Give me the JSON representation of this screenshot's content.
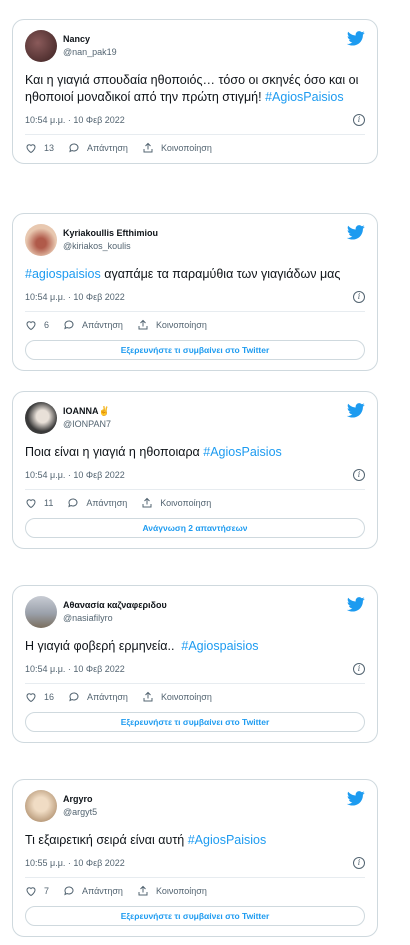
{
  "tweets": [
    {
      "display_name": "Nancy",
      "username": "@nan_pak19",
      "text_plain": "Και η γιαγιά σπουδαία ηθοποιός… τόσο οι σκηνές όσο και οι ηθοποιοί μοναδικοί από την πρώτη στιγμή! ",
      "hashtag": "#AgiosPaisios",
      "timestamp": "10:54 μ.μ. · 10 Φεβ 2022",
      "likes": "13",
      "reply_label": "Απάντηση",
      "share_label": "Κοινοποίηση",
      "avatar_color": "#5a3a3a"
    },
    {
      "display_name": "Kyriakoullis Efthimiou",
      "username": "@kiriakos_koulis",
      "hashtag_first": "#agiospaisios",
      "text_after": " αγαπάμε τα παραμύθια των γιαγιάδων μας",
      "timestamp": "10:54 μ.μ. · 10 Φεβ 2022",
      "likes": "6",
      "reply_label": "Απάντηση",
      "share_label": "Κοινοποίηση",
      "button_label": "Εξερευνήστε τι συμβαίνει στο Twitter",
      "avatar_color": "#c98a7a"
    },
    {
      "display_name": "IOANNA✌",
      "username": "@IONPAN7",
      "text_plain": "Ποια είναι η γιαγιά η ηθοποιαρα ",
      "hashtag": "#AgiosPaisios",
      "timestamp": "10:54 μ.μ. · 10 Φεβ 2022",
      "likes": "11",
      "reply_label": "Απάντηση",
      "share_label": "Κοινοποίηση",
      "button_label": "Ανάγνωση 2 απαντήσεων",
      "avatar_color": "#2b2b2b"
    },
    {
      "display_name": "Αθανασία καζναφεριδου",
      "username": "@nasiafilyro",
      "text_plain": "Η γιαγιά φοβερή ερμηνεία..  ",
      "hashtag": "#Agiospaisios",
      "timestamp": "10:54 μ.μ. · 10 Φεβ 2022",
      "likes": "16",
      "reply_label": "Απάντηση",
      "share_label": "Κοινοποίηση",
      "button_label": "Εξερευνήστε τι συμβαίνει στο Twitter",
      "avatar_color": "#8b8f99"
    },
    {
      "display_name": "Argyro",
      "username": "@argyt5",
      "text_plain": "Τι εξαιρετική σειρά είναι αυτή ",
      "hashtag": "#AgiosPaisios",
      "timestamp": "10:55 μ.μ. · 10 Φεβ 2022",
      "likes": "7",
      "reply_label": "Απάντηση",
      "share_label": "Κοινοποίηση",
      "button_label": "Εξερευνήστε τι συμβαίνει στο Twitter",
      "avatar_color": "#d8c2a8"
    }
  ],
  "colors": {
    "accent": "#1d9bf0",
    "border": "#cfd9de",
    "secondary_text": "#536471"
  },
  "icons": {
    "brand": "twitter-bird-icon",
    "like": "heart-icon",
    "reply": "speech-bubble-icon",
    "share": "share-icon",
    "info": "info-icon"
  }
}
